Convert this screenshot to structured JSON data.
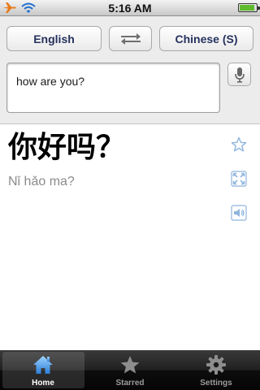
{
  "status_bar": {
    "time": "5:16 AM",
    "battery_level": 0.9,
    "icons": [
      "airplane-mode-icon",
      "wifi-icon",
      "battery-icon"
    ]
  },
  "translator": {
    "source_language": "English",
    "target_language": "Chinese (S)",
    "input_text": "how are you?"
  },
  "result": {
    "translation": "你好吗？",
    "romanization": "Nǐ hǎo ma?"
  },
  "tabs": [
    {
      "label": "Home",
      "icon": "home-icon",
      "active": true
    },
    {
      "label": "Starred",
      "icon": "star-icon",
      "active": false
    },
    {
      "label": "Settings",
      "icon": "gear-icon",
      "active": false
    }
  ],
  "colors": {
    "accent_blue": "#3c8fe0",
    "language_text": "#25325e",
    "result_icon": "#8fb5dc",
    "romanization_text": "#8b8b8b"
  }
}
